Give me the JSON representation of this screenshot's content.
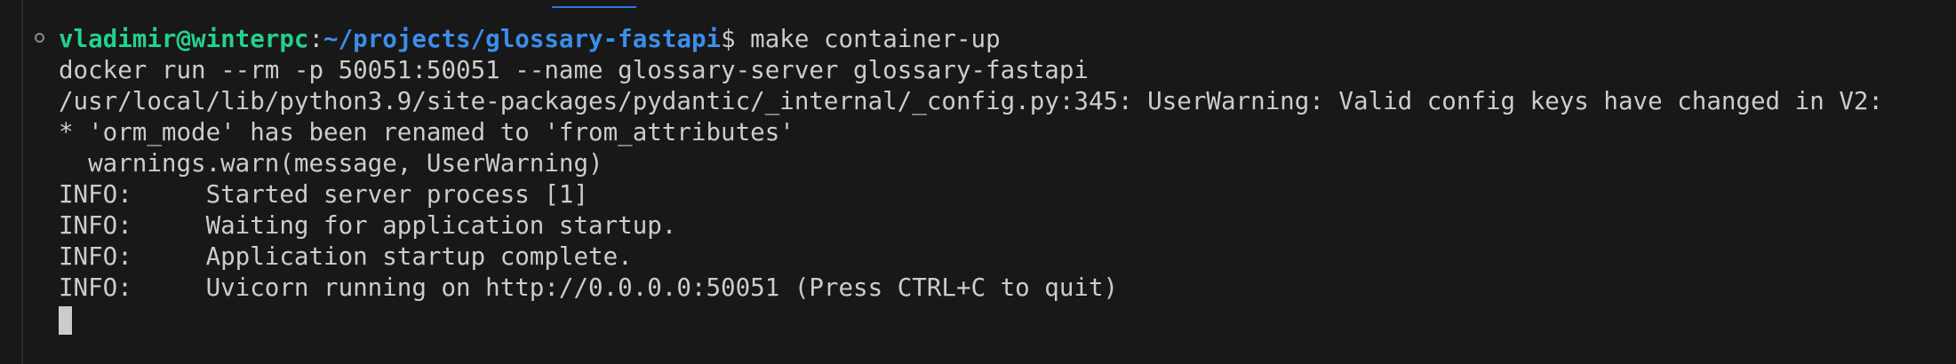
{
  "prompt": {
    "user_host": "vladimir@winterpc",
    "separator": ":",
    "path": "~/projects/glossary-fastapi",
    "sigil": "$",
    "command": " make container-up"
  },
  "output_lines": [
    "docker run --rm -p 50051:50051 --name glossary-server glossary-fastapi",
    "/usr/local/lib/python3.9/site-packages/pydantic/_internal/_config.py:345: UserWarning: Valid config keys have changed in V2:",
    "* 'orm_mode' has been renamed to 'from_attributes'",
    "  warnings.warn(message, UserWarning)",
    "INFO:     Started server process [1]",
    "INFO:     Waiting for application startup.",
    "INFO:     Application startup complete.",
    "INFO:     Uvicorn running on http://0.0.0.0:50051 (Press CTRL+C to quit)"
  ],
  "colors": {
    "background": "#181818",
    "foreground": "#cccccc",
    "user_host": "#23d18b",
    "path": "#3b8eea",
    "accent": "#2f73e0"
  },
  "icons": {
    "command_decoration": "circle-outline-icon",
    "cursor": "block-cursor"
  }
}
